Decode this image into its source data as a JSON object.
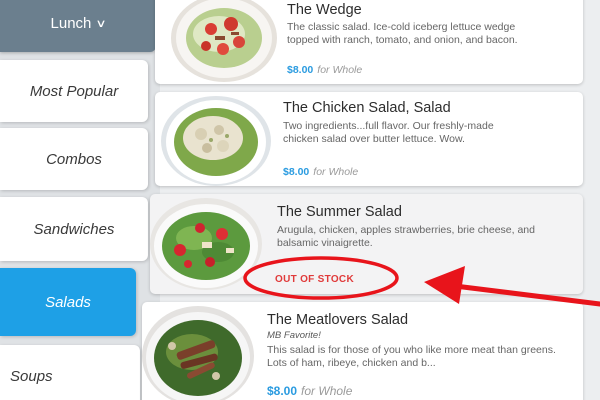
{
  "menu": {
    "selected": "Lunch"
  },
  "categories": [
    {
      "label": "Most Popular"
    },
    {
      "label": "Combos"
    },
    {
      "label": "Sandwiches"
    },
    {
      "label": "Salads"
    },
    {
      "label": "Soups"
    }
  ],
  "active_category": "Salads",
  "items": [
    {
      "title": "The Wedge",
      "description": "The classic salad. Ice-cold iceberg lettuce wedge topped with ranch, tomato, and onion, and bacon.",
      "price": "$8.00",
      "unit": "for Whole"
    },
    {
      "title": "The Chicken Salad, Salad",
      "description": "Two ingredients...full flavor. Our freshly-made chicken salad over butter lettuce. Wow.",
      "price": "$8.00",
      "unit": "for Whole"
    },
    {
      "title": "The Summer Salad",
      "description": "Arugula, chicken, apples strawberries, brie cheese, and balsamic vinaigrette.",
      "status": "OUT OF STOCK"
    },
    {
      "title": "The Meatlovers Salad",
      "subtitle": "MB Favorite!",
      "description": "This salad is for those of you who like more meat than greens. Lots of ham, ribeye, chicken and b...",
      "price": "$8.00",
      "unit": "for Whole"
    }
  ],
  "colors": {
    "accent": "#1ea0e6",
    "out_of_stock": "#e03a3a",
    "annotation": "#e8141b",
    "header": "#6b7f8e"
  }
}
